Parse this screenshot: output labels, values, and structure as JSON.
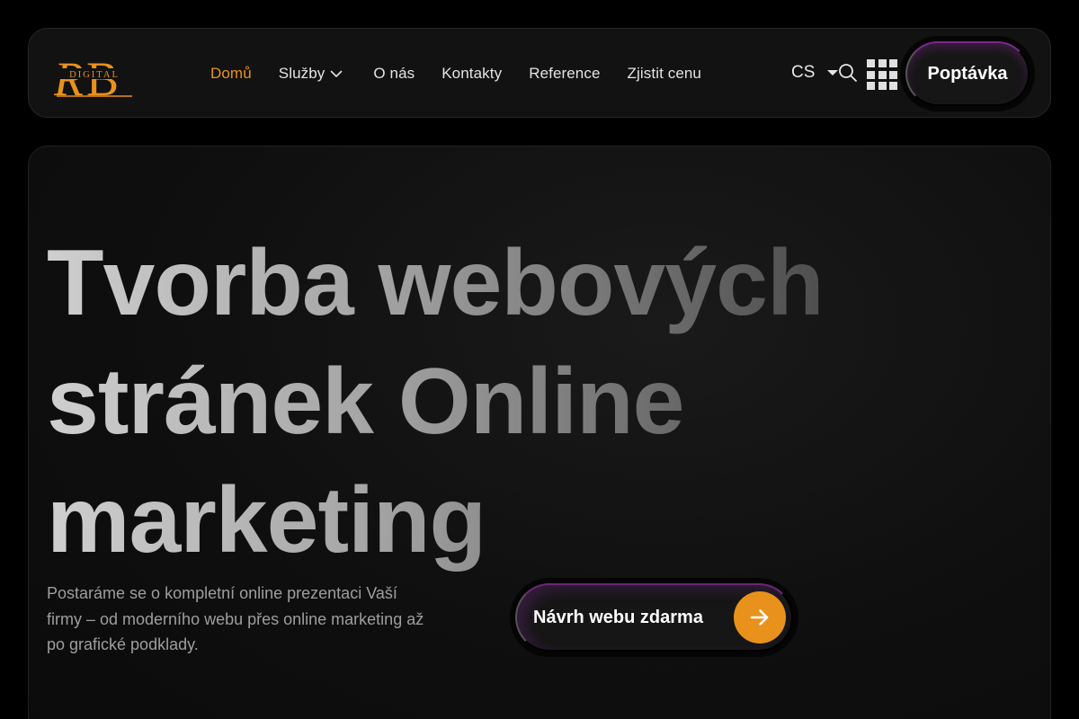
{
  "brand": {
    "logo_letters": "RB",
    "logo_subtext": "DIGITAL",
    "accent_color": "#e8921c"
  },
  "nav": {
    "items": [
      {
        "label": "Domů",
        "active": true
      },
      {
        "label": "Služby",
        "has_dropdown": true
      },
      {
        "label": "O nás"
      },
      {
        "label": "Kontakty"
      },
      {
        "label": "Reference"
      },
      {
        "label": "Zjistit cenu"
      }
    ],
    "language": "CS",
    "cta_label": "Poptávka",
    "icons": [
      "chevron-down-icon",
      "caret-down-icon",
      "search-icon",
      "apps-grid-icon"
    ]
  },
  "hero": {
    "title_line_1": "Tvorba webových",
    "title_line_2": "stránek Online",
    "title_line_3": "marketing",
    "description": "Postaráme se o kompletní online prezentaci Vaší firmy – od moderního webu přes online marketing až po grafické podklady.",
    "cta_label": "Návrh webu zdarma",
    "cta_icon": "arrow-right-icon"
  }
}
